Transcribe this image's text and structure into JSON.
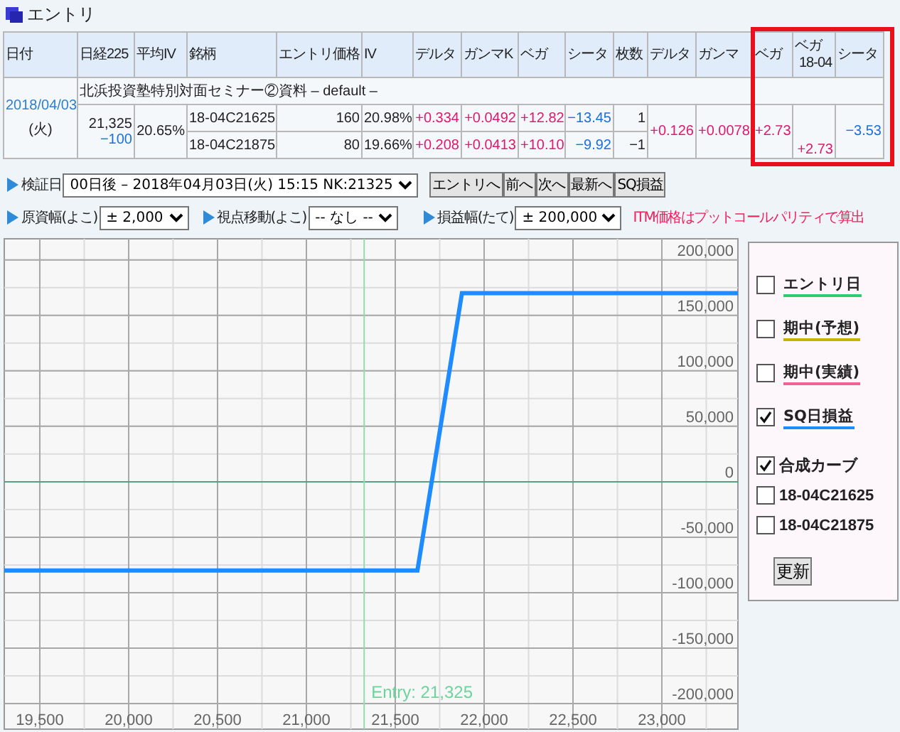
{
  "section": {
    "title": "エントリ"
  },
  "table": {
    "columns": [
      {
        "label": "日付"
      },
      {
        "label": "日経225"
      },
      {
        "label": "平均IV"
      },
      {
        "label": "銘柄"
      },
      {
        "label": "エントリ価格"
      },
      {
        "label": "IV"
      },
      {
        "label": "デルタ"
      },
      {
        "label": "ガンマK"
      },
      {
        "label": "ベガ"
      },
      {
        "label": "シータ"
      },
      {
        "label": "枚数"
      },
      {
        "label": "デルタ"
      },
      {
        "label": "ガンマ"
      },
      {
        "label": "ベガ",
        "highlighted": true
      },
      {
        "label": "ベガ",
        "sublabel": "18-04",
        "highlighted": true
      },
      {
        "label": "シータ",
        "highlighted": true
      }
    ],
    "title_row": "北浜投資塾特別対面セミナー②資料 – default –",
    "date": "2018/04/03",
    "weekday": "(火)",
    "nikkei": "21,325",
    "nikkei_change": {
      "text": "−100",
      "color": "#1c6fe0"
    },
    "avg_iv": "20.65%",
    "rows": [
      {
        "issue": "18-04C21625",
        "price": "160",
        "iv": "20.98%",
        "delta": {
          "text": "+0.334",
          "color": "#e0186e"
        },
        "gamma_k": {
          "text": "+0.0492",
          "color": "#e0186e"
        },
        "vega": {
          "text": "+12.82",
          "color": "#e0186e"
        },
        "theta": {
          "text": "−13.45",
          "color": "#1c6fe0"
        },
        "quantity": "1"
      },
      {
        "issue": "18-04C21875",
        "price": "80",
        "iv": "19.66%",
        "delta": {
          "text": "+0.208",
          "color": "#e0186e"
        },
        "gamma_k": {
          "text": "+0.0413",
          "color": "#e0186e"
        },
        "vega": {
          "text": "+10.10",
          "color": "#e0186e"
        },
        "theta": {
          "text": "−9.92",
          "color": "#1c6fe0"
        },
        "quantity": "−1"
      }
    ],
    "totals": {
      "delta": {
        "text": "+0.126",
        "color": "#e0186e"
      },
      "gamma": {
        "text": "+0.0078",
        "color": "#e0186e"
      },
      "vega": {
        "text": "+2.73",
        "color": "#e0186e"
      },
      "vega_18_04": {
        "text": "+2.73",
        "color": "#e0186e"
      },
      "theta": {
        "text": "−3.53",
        "color": "#1c6fe0"
      }
    }
  },
  "controls": {
    "date": {
      "label": "検証日",
      "value": "00日後 – 2018年04月03日(火) 15:15 NK:21325"
    },
    "buttons": [
      "エントリへ",
      "前へ",
      "次へ",
      "最新へ",
      "SQ損益"
    ],
    "x_range": {
      "label": "原資幅(よこ)",
      "value": "± 2,000"
    },
    "view_shift": {
      "label": "視点移動(よこ)",
      "value": "-- なし --"
    },
    "y_range": {
      "label": "損益幅(たて)",
      "value": "± 200,000"
    },
    "note": "ITM価格はプットコールパリティで算出"
  },
  "chart": {
    "chart_data": {
      "type": "line",
      "x": [
        19300,
        21625,
        21875,
        23428
      ],
      "series": [
        {
          "color": "#1e8cff",
          "values": [
            -80000,
            -80000,
            170000,
            170000
          ]
        }
      ],
      "xlim": [
        19300,
        23428
      ],
      "ylim": [
        -223000,
        219000
      ],
      "xticks": [
        {
          "value": 19500,
          "label": "19,500"
        },
        {
          "value": 20000,
          "label": "20,000"
        },
        {
          "value": 20500,
          "label": "20,500"
        },
        {
          "value": 21000,
          "label": "21,000"
        },
        {
          "value": 21500,
          "label": "21,500"
        },
        {
          "value": 22000,
          "label": "22,000"
        },
        {
          "value": 22500,
          "label": "22,500"
        },
        {
          "value": 23000,
          "label": "23,000"
        }
      ],
      "yticks": [
        {
          "value": 200000,
          "label": "200,000"
        },
        {
          "value": 150000,
          "label": "150,000"
        },
        {
          "value": 100000,
          "label": "100,000"
        },
        {
          "value": 50000,
          "label": "50,000"
        },
        {
          "value": 0,
          "label": "0"
        },
        {
          "value": -50000,
          "label": "-50,000"
        },
        {
          "value": -100000,
          "label": "-100,000"
        },
        {
          "value": -150000,
          "label": "-150,000"
        },
        {
          "value": -200000,
          "label": "-200,000"
        }
      ],
      "grid": true,
      "ref_lines": [
        {
          "axis": "y",
          "value": 0,
          "color": "#5aa080"
        },
        {
          "axis": "x",
          "value": 21325,
          "color": "#8fdcae"
        }
      ],
      "annotations": [
        "Entry: 21,325"
      ]
    }
  },
  "legend": {
    "items": [
      {
        "kind": "curve",
        "label": "エントリ日",
        "color": "#2ecc71",
        "checked": false
      },
      {
        "kind": "curve",
        "label": "期中(予想)",
        "color": "#c8b400",
        "checked": false
      },
      {
        "kind": "curve",
        "label": "期中(実績)",
        "color": "#f06292",
        "checked": false
      },
      {
        "kind": "curve",
        "label": "SQ日損益",
        "color": "#1e8cff",
        "checked": true
      },
      {
        "kind": "position",
        "label": "合成カーブ",
        "checked": true
      },
      {
        "kind": "position",
        "label": "18-04C21625",
        "checked": false
      },
      {
        "kind": "position",
        "label": "18-04C21875",
        "checked": false
      }
    ],
    "button": "更新"
  }
}
